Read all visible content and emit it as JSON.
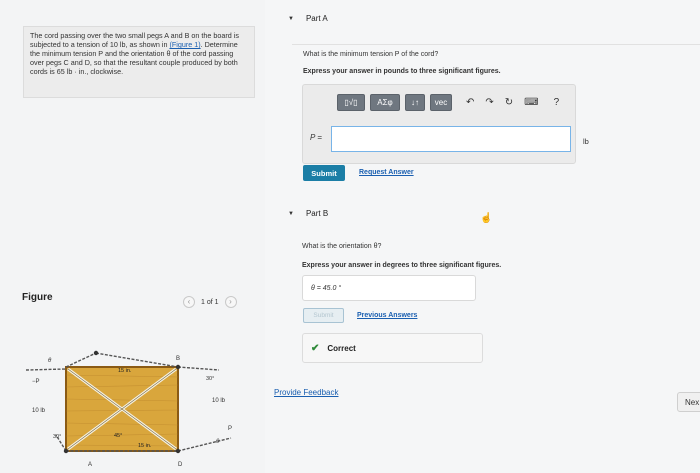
{
  "problem": {
    "text_before_link": "The cord passing over the two small pegs A and B on the board is subjected to a tension of 10 lb, as shown in",
    "link_text": "(Figure 1)",
    "text_after_link": ". Determine the minimum tension P and the orientation θ of the cord passing over pegs C and D, so that the resultant couple produced by both cords is 65 lb · in., clockwise."
  },
  "figure_panel": {
    "label": "Figure",
    "pager_text": "1 of 1",
    "prev_icon": "chevron-left-icon",
    "next_icon": "chevron-right-icon",
    "labels": {
      "theta": "θ",
      "p_left": "−P",
      "c": "C",
      "b": "B",
      "a": "A",
      "d": "D",
      "dim_top": "15 in.",
      "dim_bottom": "15 in.",
      "angle_30_right": "30°",
      "angle_30_left": "30°",
      "angle_45": "45°",
      "force_left": "10 lb",
      "force_right": "10 lb",
      "p_right": "P",
      "theta_right": "θ"
    },
    "colors": {
      "board": "#d9a63c",
      "board_edge": "#8a5a14",
      "cord": "#555555"
    }
  },
  "part_a": {
    "title": "Part A",
    "question": "What is the minimum tension P of the cord?",
    "instruction": "Express your answer in pounds to three significant figures.",
    "toolbar": {
      "template_btn": "▯√▯",
      "greek_btn": "ΑΣφ",
      "arrows_btn": "↓↑",
      "vec_btn": "vec",
      "undo_icon": "undo-icon",
      "redo_icon": "redo-icon",
      "reset_icon": "reset-icon",
      "keyboard_icon": "keyboard-icon",
      "help_label": "?"
    },
    "input_label": "P =",
    "input_value": "",
    "unit": "lb",
    "submit_label": "Submit",
    "request_answer_label": "Request Answer"
  },
  "part_b": {
    "title": "Part B",
    "question": "What is the orientation θ?",
    "instruction": "Express your answer in degrees to three significant figures.",
    "answer_text": "θ = 45.0 °",
    "submit_label": "Submit",
    "previous_answers_label": "Previous Answers",
    "status_label": "Correct"
  },
  "footer": {
    "feedback_label": "Provide Feedback",
    "next_label": "Nex"
  },
  "colors": {
    "accent": "#1b7ea6",
    "link": "#1a5fb0",
    "correct": "#2f8a3a"
  }
}
